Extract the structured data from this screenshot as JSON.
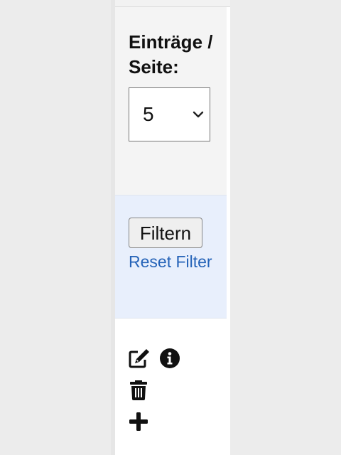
{
  "filter_form": {
    "per_page_label": "Einträge / Seite:",
    "per_page_selected": "5",
    "filter_button_label": "Filtern",
    "reset_link_label": "Reset Filter"
  },
  "actions": {
    "icons": [
      "edit-icon",
      "info-icon",
      "trash-icon",
      "plus-icon"
    ]
  }
}
